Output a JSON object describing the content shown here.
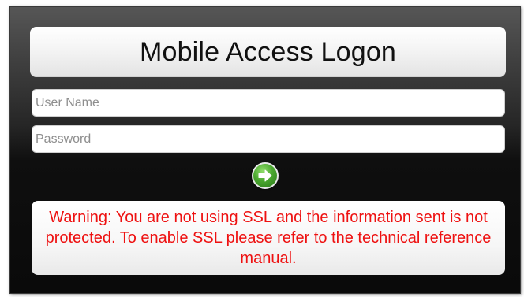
{
  "logon": {
    "title": "Mobile Access Logon",
    "username_placeholder": "User Name",
    "username_value": "",
    "password_placeholder": "Password",
    "password_value": "",
    "submit_icon": "arrow-right-icon",
    "warning": "Warning: You are not using SSL and the information sent is not protected. To enable SSL please refer to the technical reference manual."
  },
  "colors": {
    "warning_text": "#ee1111",
    "submit_green": "#4aa72f",
    "panel_dark": "#0a0a0a"
  }
}
